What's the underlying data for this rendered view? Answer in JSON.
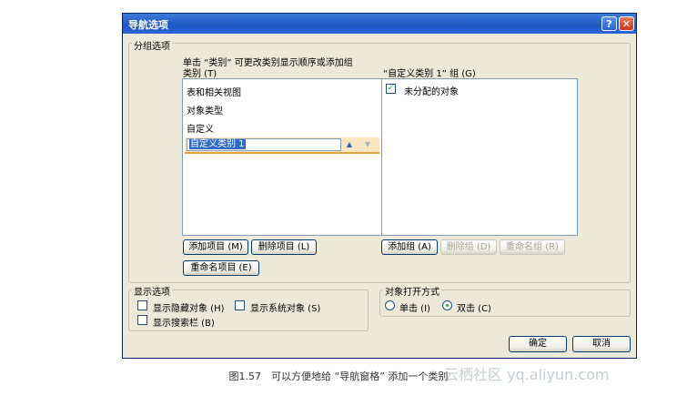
{
  "dialog": {
    "title": "导航选项",
    "help_label": "?",
    "close_label": "✕",
    "grouping_options": {
      "legend": "分组选项",
      "instruction": "单击 “类别” 可更改类别显示顺序或添加组",
      "categories_label": "类别 (T)",
      "groups_label": "“自定义类别 1” 组 (G)",
      "categories": [
        "表和相关视图",
        "对象类型",
        "自定义"
      ],
      "editing_category": "自定义类别 1",
      "move_up_icon": "▲",
      "move_down_icon": "▼",
      "groups": [
        {
          "label": "未分配的对象",
          "checked": true
        }
      ],
      "check_mark": "✓",
      "add_item_button": "添加项目 (M)",
      "delete_item_button": "删除项目 (L)",
      "rename_item_button": "重命名项目 (E)",
      "add_group_button": "添加组 (A)",
      "delete_group_button": "删除组 (D)",
      "rename_group_button": "重命名组 (R)"
    },
    "display_options": {
      "legend": "显示选项",
      "show_hidden": "显示隐藏对象 (H)",
      "show_system": "显示系统对象 (S)",
      "show_search": "显示搜索栏 (B)"
    },
    "open_mode": {
      "legend": "对象打开方式",
      "single_click": "单击 (I)",
      "double_click": "双击 (C)",
      "selected": "double_click"
    },
    "ok_button": "确定",
    "cancel_button": "取消"
  },
  "caption": "图1.57　可以方便地给 “导航窗格” 添加一个类别",
  "watermark": "云栖社区 yq.aliyun.com"
}
